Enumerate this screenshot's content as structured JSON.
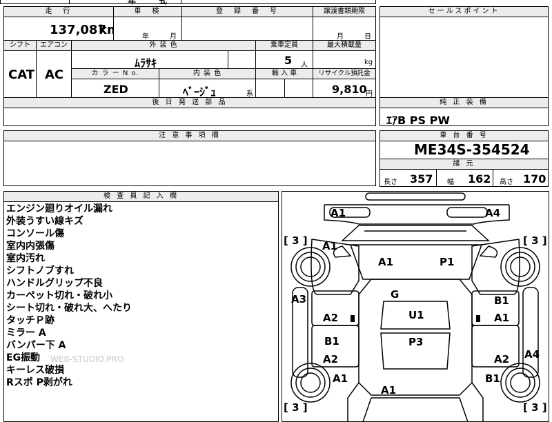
{
  "top_partial": [
    "年",
    "式"
  ],
  "sheet": {
    "mileage_label": "走　行",
    "mileage_value": "137,087",
    "mileage_unit": "km",
    "inspection_label": "車　検",
    "inspection_year": "年",
    "inspection_month": "月",
    "registration_label": "登　録　番　号",
    "transfer_label": "譲渡書類期限",
    "transfer_month": "月",
    "transfer_day": "日",
    "shift_label": "シフト",
    "aircon_label": "エアコン",
    "shift_value": "CAT",
    "aircon_value": "AC",
    "exterior_color_label": "外 装 色",
    "exterior_color_value": "ﾑﾗｻｷ",
    "color_no_label": "カ ラ ー  N o.",
    "color_no_value": "ZED",
    "interior_color_label": "内 装 色",
    "interior_color_value": "ﾍﾞｰｼﾞｭ",
    "interior_color_suffix": "系",
    "capacity_label": "乗車定員",
    "capacity_value": "5",
    "capacity_unit": "人",
    "max_load_label": "最大積載量",
    "max_load_unit": "kg",
    "import_label": "輸 入 車",
    "recycle_label": "リサイクル預託金",
    "recycle_value": "9,810",
    "recycle_unit": "円",
    "later_parts_label": "後 日 発 送 部 品",
    "notes_label": "注 意 事 項 欄"
  },
  "sales_point": {
    "label": "セールスポイント"
  },
  "genuine_equipment": {
    "label": "純 正 装 備",
    "value": "ｴｱB PS PW"
  },
  "chassis": {
    "label": "車 台 番 号",
    "value": "ME34S-354524"
  },
  "specs": {
    "label": "諸 元",
    "length_label": "長さ",
    "length_value": "357",
    "width_label": "幅",
    "width_value": "162",
    "height_label": "高さ",
    "height_value": "170"
  },
  "inspector": {
    "label": "検 査 員 記 入 欄",
    "notes": [
      "エンジン廻りオイル漏れ",
      "外装うすい線キズ",
      "コンソール傷",
      "室内内張傷",
      "室内汚れ",
      "シフトノブすれ",
      "ハンドルグリップ不良",
      "カーペット切れ・破れ小",
      "シート切れ・破れ大、へたり",
      "タッチＰ跡",
      "ミラー A",
      "バンパー下 A",
      "EG振動",
      "キーレス破損",
      "Rスポ P剥がれ"
    ],
    "watermark": "WEB-STUDIO.PRO"
  },
  "diagram": {
    "tires": [
      "[ 3 ]",
      "[ 3 ]",
      "[ 3 ]",
      "[ 3 ]"
    ],
    "marks": [
      "A1",
      "A4",
      "A1",
      "A1",
      "P1",
      "A3",
      "G",
      "B1",
      "A2",
      "U1",
      "A1",
      "B1",
      "P3",
      "A2",
      "A2",
      "A4",
      "A1",
      "B1",
      "A1"
    ]
  }
}
